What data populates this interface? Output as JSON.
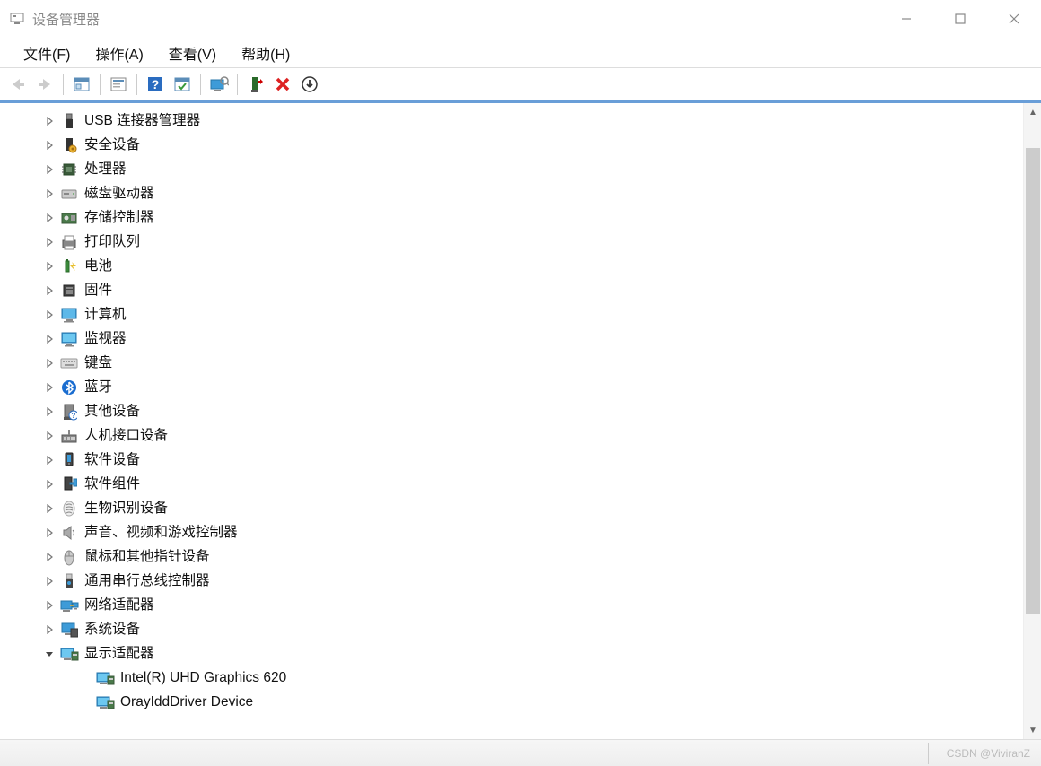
{
  "window": {
    "title": "设备管理器"
  },
  "menu": {
    "file": "文件(F)",
    "action": "操作(A)",
    "view": "查看(V)",
    "help": "帮助(H)"
  },
  "toolbar": {
    "back": "back-icon",
    "forward": "forward-icon",
    "up_folder": "properties-panel-icon",
    "properties": "properties-icon",
    "help": "help-icon",
    "show_hidden": "show-hidden-icon",
    "scan": "scan-hardware-icon",
    "add_legacy": "add-legacy-icon",
    "remove": "remove-icon",
    "update": "update-driver-icon"
  },
  "tree": [
    {
      "icon": "usb-connector-icon",
      "label": "USB 连接器管理器",
      "expanded": false,
      "level": 0
    },
    {
      "icon": "security-device-icon",
      "label": "安全设备",
      "expanded": false,
      "level": 0
    },
    {
      "icon": "processor-icon",
      "label": "处理器",
      "expanded": false,
      "level": 0
    },
    {
      "icon": "disk-drive-icon",
      "label": "磁盘驱动器",
      "expanded": false,
      "level": 0
    },
    {
      "icon": "storage-controller-icon",
      "label": "存储控制器",
      "expanded": false,
      "level": 0
    },
    {
      "icon": "print-queue-icon",
      "label": "打印队列",
      "expanded": false,
      "level": 0
    },
    {
      "icon": "battery-icon",
      "label": "电池",
      "expanded": false,
      "level": 0
    },
    {
      "icon": "firmware-icon",
      "label": "固件",
      "expanded": false,
      "level": 0
    },
    {
      "icon": "computer-icon",
      "label": "计算机",
      "expanded": false,
      "level": 0
    },
    {
      "icon": "monitor-icon",
      "label": "监视器",
      "expanded": false,
      "level": 0
    },
    {
      "icon": "keyboard-icon",
      "label": "键盘",
      "expanded": false,
      "level": 0
    },
    {
      "icon": "bluetooth-icon",
      "label": "蓝牙",
      "expanded": false,
      "level": 0
    },
    {
      "icon": "other-device-icon",
      "label": "其他设备",
      "expanded": false,
      "level": 0
    },
    {
      "icon": "hid-icon",
      "label": "人机接口设备",
      "expanded": false,
      "level": 0
    },
    {
      "icon": "software-device-icon",
      "label": "软件设备",
      "expanded": false,
      "level": 0
    },
    {
      "icon": "software-component-icon",
      "label": "软件组件",
      "expanded": false,
      "level": 0
    },
    {
      "icon": "biometric-icon",
      "label": "生物识别设备",
      "expanded": false,
      "level": 0
    },
    {
      "icon": "sound-icon",
      "label": "声音、视频和游戏控制器",
      "expanded": false,
      "level": 0
    },
    {
      "icon": "mouse-icon",
      "label": "鼠标和其他指针设备",
      "expanded": false,
      "level": 0
    },
    {
      "icon": "usb-controller-icon",
      "label": "通用串行总线控制器",
      "expanded": false,
      "level": 0
    },
    {
      "icon": "network-adapter-icon",
      "label": "网络适配器",
      "expanded": false,
      "level": 0
    },
    {
      "icon": "system-device-icon",
      "label": "系统设备",
      "expanded": false,
      "level": 0
    },
    {
      "icon": "display-adapter-icon",
      "label": "显示适配器",
      "expanded": true,
      "level": 0
    },
    {
      "icon": "display-adapter-child-icon",
      "label": "Intel(R) UHD Graphics 620",
      "expanded": null,
      "level": 1
    },
    {
      "icon": "display-adapter-child-icon",
      "label": "OrayIddDriver Device",
      "expanded": null,
      "level": 1
    }
  ],
  "watermark": "CSDN @ViviranZ"
}
